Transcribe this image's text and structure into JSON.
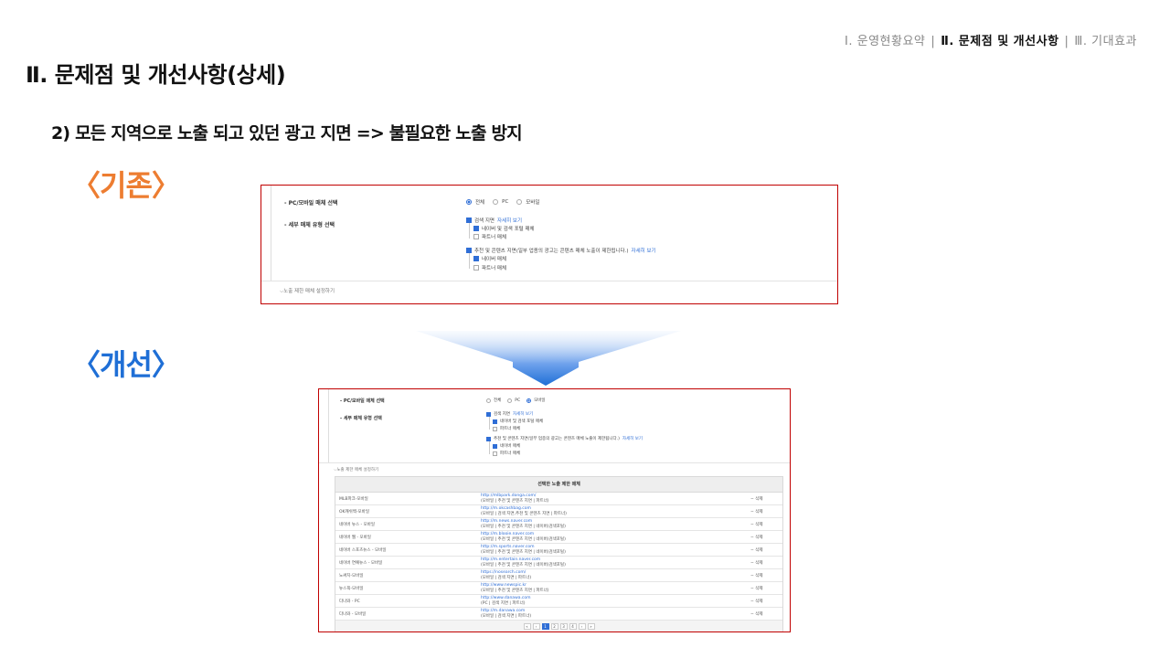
{
  "nav": {
    "item1": "Ⅰ. 운영현황요약",
    "item2": "Ⅱ. 문제점 및 개선사항",
    "item3": "Ⅲ. 기대효과"
  },
  "title": "Ⅱ. 문제점 및 개선사항(상세)",
  "subtitle": "2) 모든 지역으로 노출 되고 있던 광고 지면 => 불필요한 노출 방지",
  "before_label": "〈기존〉",
  "after_label": "〈개선〉",
  "colors": {
    "before": "#ed7d31",
    "after": "#1f6fd6",
    "frame": "#c00000",
    "arrow": "#2f6ed6"
  },
  "form": {
    "media_label": "- PC/모바일 매체 선택",
    "media_options": [
      "전체",
      "PC",
      "모바일"
    ],
    "detail_label": "- 세부 매체 유형 선택",
    "search_area": "검색 지면",
    "detail_link": "자세히 보기",
    "naver_search_portal": "네이버 및 검색 포털 매체",
    "partner_media": "파트너 매체",
    "content_area": "추천 및 콘텐츠 지면(일부 업종의 광고는 콘텐츠 매체 노출이 제한됩니다.)",
    "naver_media": "네이버 매체",
    "expand_label": "노출 제한 매체 설정하기"
  },
  "before": {
    "selected_media": 0
  },
  "after": {
    "selected_media": 2
  },
  "table": {
    "header": "선택한 노출 제한 매체",
    "delete_label": "삭제",
    "rows": [
      {
        "name": "MLB파크-모바일",
        "url": "http://mlbpark.donga.com/",
        "desc": "(모바일 | 추천 및 콘텐츠 지면 | 파트너)"
      },
      {
        "name": "OK캐쉬백-모바일",
        "url": "http://m.okcashbag.com",
        "desc": "(모바일 | 검색 지면,추천 및 콘텐츠 지면 | 파트너)"
      },
      {
        "name": "네이버 뉴스 - 모바일",
        "url": "http://m.news.naver.com",
        "desc": "(모바일 | 추천 및 콘텐츠 지면 | 네이버(검색포털)"
      },
      {
        "name": "네이버 웹 - 모바일",
        "url": "http://m.blooie.naver.com",
        "desc": "(모바일 | 추천 및 콘텐츠 지면 | 네이버(검색포털)"
      },
      {
        "name": "네이버 스포츠뉴스 - 모바일",
        "url": "http://m.sports.naver.com",
        "desc": "(모바일 | 추천 및 콘텐츠 지면 | 네이버(검색포털)"
      },
      {
        "name": "네이버 연예뉴스 - 모바일",
        "url": "http://m.entertain.naver.com",
        "desc": "(모바일 | 추천 및 콘텐츠 지면 | 네이버(검색포털)"
      },
      {
        "name": "노써치-모바일",
        "url": "https://nosearch.com/",
        "desc": "(모바일 | 검색 지면 | 파트너)"
      },
      {
        "name": "뉴스픽-모바일",
        "url": "http://www.newspic.kr",
        "desc": "(모바일 | 추천 및 콘텐츠 지면 | 파트너)"
      },
      {
        "name": "다나와 - PC",
        "url": "http://www.danawa.com",
        "desc": "(PC | 검색 지면 | 파트너)"
      },
      {
        "name": "다나와 - 모바일",
        "url": "http://m.danawa.com",
        "desc": "(모바일 | 검색 지면 | 파트너)"
      }
    ],
    "pages": [
      "«",
      "‹",
      "1",
      "2",
      "3",
      "4",
      "›",
      "»"
    ],
    "current_page": "1"
  }
}
